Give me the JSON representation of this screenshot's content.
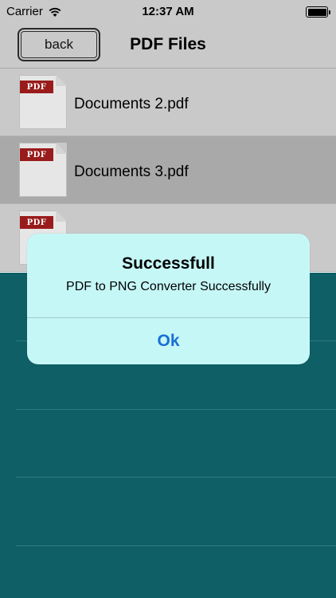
{
  "status_bar": {
    "carrier": "Carrier",
    "time": "12:37 AM"
  },
  "nav": {
    "back_label": "back",
    "title": "PDF Files"
  },
  "files": [
    {
      "name": "Documents 2.pdf",
      "icon_text": "PDF",
      "selected": false
    },
    {
      "name": "Documents 3.pdf",
      "icon_text": "PDF",
      "selected": true
    },
    {
      "name": "",
      "icon_text": "PDF",
      "selected": false
    }
  ],
  "alert": {
    "title": "Successfull",
    "message": "PDF to PNG Converter Successfully",
    "ok_label": "Ok"
  },
  "colors": {
    "bar_gray": "#c9c9c9",
    "selected_row": "#a9a9a9",
    "teal": "#0e5f66",
    "alert_bg": "#c6f7f7",
    "alert_button": "#1a6fd6",
    "pdf_label": "#9a1b1b"
  }
}
